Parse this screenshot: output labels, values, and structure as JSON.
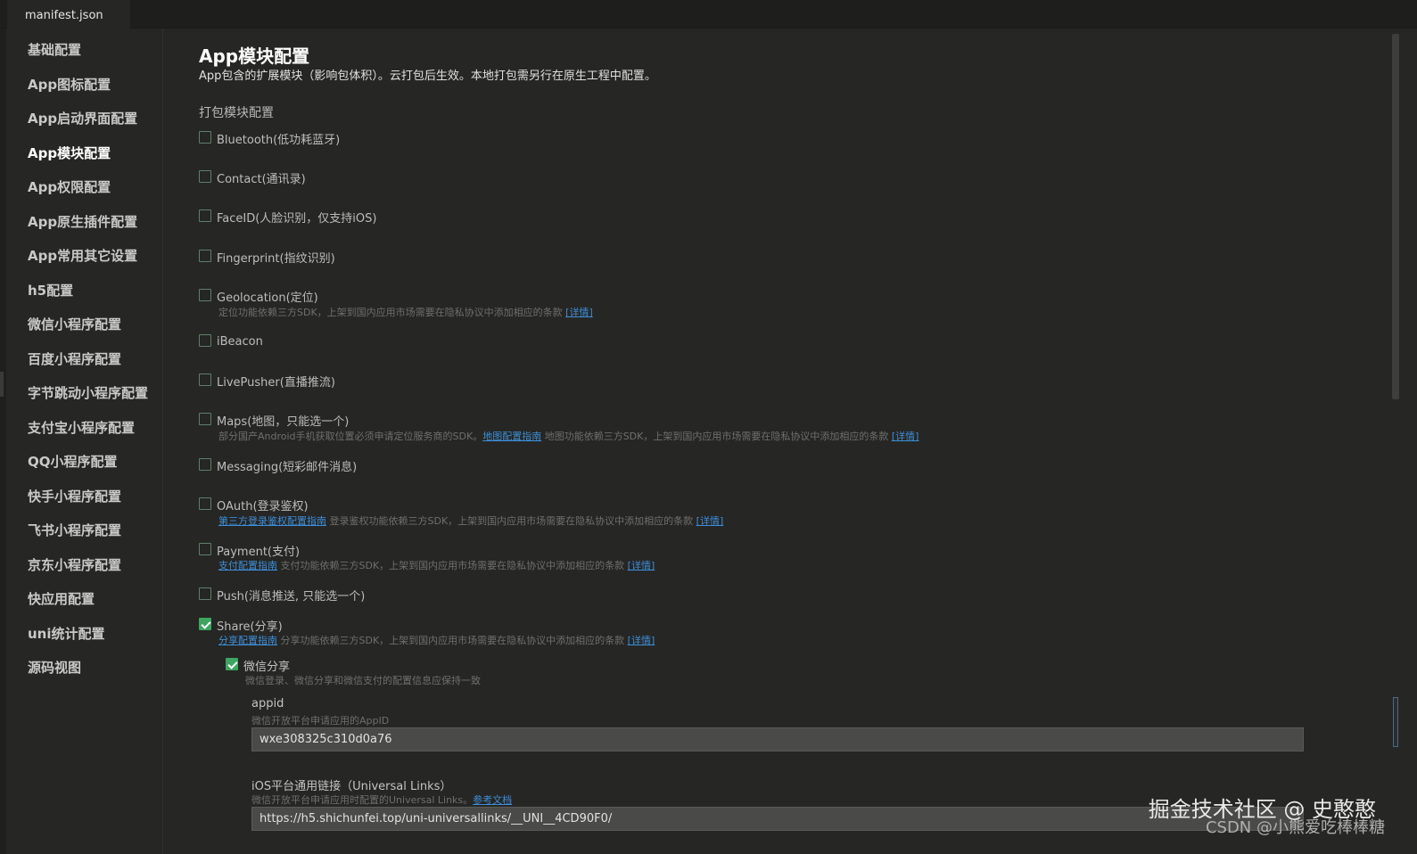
{
  "tab": {
    "filename": "manifest.json"
  },
  "sidebar": {
    "items": [
      {
        "label": "基础配置"
      },
      {
        "label": "App图标配置"
      },
      {
        "label": "App启动界面配置"
      },
      {
        "label": "App模块配置",
        "active": true
      },
      {
        "label": "App权限配置"
      },
      {
        "label": "App原生插件配置"
      },
      {
        "label": "App常用其它设置"
      },
      {
        "label": "h5配置"
      },
      {
        "label": "微信小程序配置"
      },
      {
        "label": "百度小程序配置"
      },
      {
        "label": "字节跳动小程序配置"
      },
      {
        "label": "支付宝小程序配置"
      },
      {
        "label": "QQ小程序配置"
      },
      {
        "label": "快手小程序配置"
      },
      {
        "label": "飞书小程序配置"
      },
      {
        "label": "京东小程序配置"
      },
      {
        "label": "快应用配置"
      },
      {
        "label": "uni统计配置"
      },
      {
        "label": "源码视图"
      }
    ]
  },
  "main": {
    "title": "App模块配置",
    "subtitle": "App包含的扩展模块（影响包体积）。云打包后生效。本地打包需另行在原生工程中配置。",
    "section_title": "打包模块配置",
    "modules": {
      "bluetooth": {
        "label": "Bluetooth(低功耗蓝牙)",
        "checked": false
      },
      "contact": {
        "label": "Contact(通讯录)",
        "checked": false
      },
      "faceid": {
        "label": "FaceID(人脸识别，仅支持iOS)",
        "checked": false
      },
      "fingerprint": {
        "label": "Fingerprint(指纹识别)",
        "checked": false
      },
      "geolocation": {
        "label": "Geolocation(定位)",
        "checked": false,
        "desc": "定位功能依赖三方SDK，上架到国内应用市场需要在隐私协议中添加相应的条款",
        "detail_link": "[详情]"
      },
      "ibeacon": {
        "label": "iBeacon",
        "checked": false
      },
      "livepusher": {
        "label": "LivePusher(直播推流)",
        "checked": false
      },
      "maps": {
        "label": "Maps(地图，只能选一个)",
        "checked": false,
        "desc_pre": "部分国产Android手机获取位置必须申请定位服务商的SDK。",
        "guide_link": "地图配置指南",
        "desc_post": "地图功能依赖三方SDK，上架到国内应用市场需要在隐私协议中添加相应的条款",
        "detail_link": "[详情]"
      },
      "messaging": {
        "label": "Messaging(短彩邮件消息)",
        "checked": false
      },
      "oauth": {
        "label": "OAuth(登录鉴权)",
        "checked": false,
        "guide_link": "第三方登录鉴权配置指南",
        "desc": "登录鉴权功能依赖三方SDK，上架到国内应用市场需要在隐私协议中添加相应的条款",
        "detail_link": "[详情]"
      },
      "payment": {
        "label": "Payment(支付)",
        "checked": false,
        "guide_link": "支付配置指南",
        "desc": "支付功能依赖三方SDK，上架到国内应用市场需要在隐私协议中添加相应的条款",
        "detail_link": "[详情]"
      },
      "push": {
        "label": "Push(消息推送, 只能选一个)",
        "checked": false
      },
      "share": {
        "label": "Share(分享)",
        "checked": true,
        "guide_link": "分享配置指南",
        "desc": "分享功能依赖三方SDK，上架到国内应用市场需要在隐私协议中添加相应的条款",
        "detail_link": "[详情]",
        "weixin": {
          "label": "微信分享",
          "checked": true,
          "desc": "微信登录、微信分享和微信支付的配置信息应保持一致",
          "appid_label": "appid",
          "appid_hint": "微信开放平台申请应用的AppID",
          "appid_value": "wxe308325c310d0a76",
          "ul_label": "iOS平台通用链接（Universal Links）",
          "ul_hint": "微信开放平台申请应用时配置的Universal Links。",
          "ul_doc_link": "参考文档",
          "ul_value": "https://h5.shichunfei.top/uni-universallinks/__UNI__4CD90F0/"
        }
      }
    }
  },
  "watermark": {
    "line1": "掘金技术社区 @ 史憨憨",
    "line2": "CSDN @小熊爱吃棒棒糖"
  }
}
